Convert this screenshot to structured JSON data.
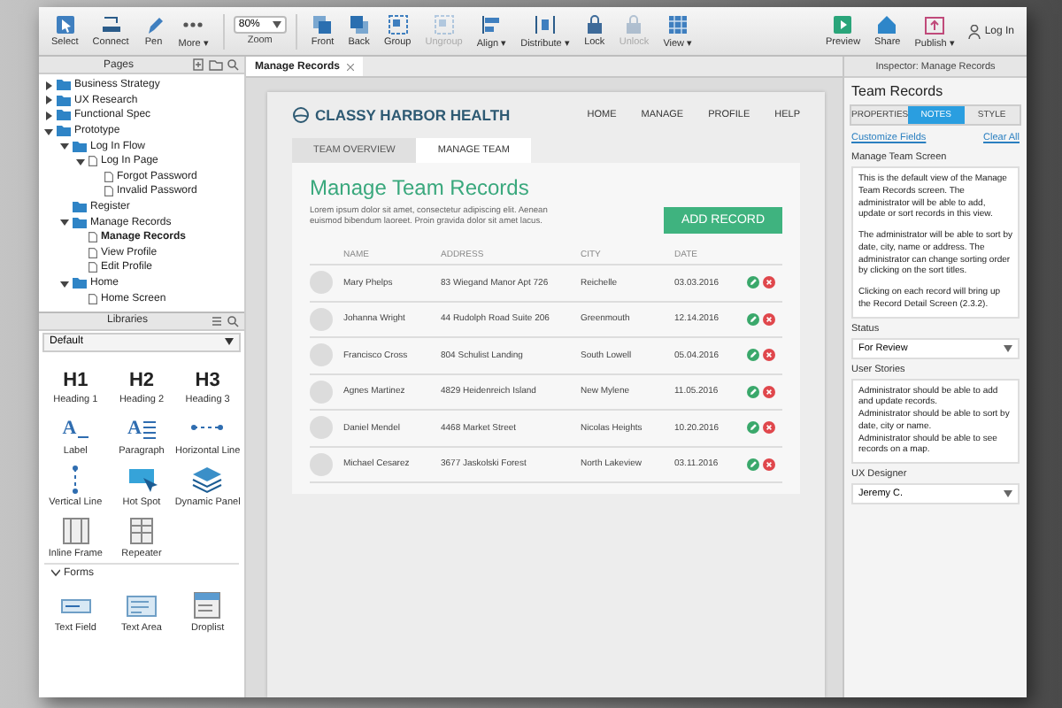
{
  "toolbar": {
    "tools": [
      {
        "label": "Select",
        "kind": "select"
      },
      {
        "label": "Connect",
        "kind": "connect"
      },
      {
        "label": "Pen",
        "kind": "pen"
      },
      {
        "label": "More ▾",
        "kind": "more"
      }
    ],
    "zoom": {
      "value": "80%",
      "label": "Zoom"
    },
    "arrange": [
      {
        "label": "Front",
        "kind": "front",
        "disabled": false
      },
      {
        "label": "Back",
        "kind": "back",
        "disabled": false
      },
      {
        "label": "Group",
        "kind": "group",
        "disabled": false
      },
      {
        "label": "Ungroup",
        "kind": "group",
        "disabled": true
      },
      {
        "label": "Align ▾",
        "kind": "align",
        "disabled": false
      },
      {
        "label": "Distribute ▾",
        "kind": "distribute",
        "disabled": false
      },
      {
        "label": "Lock",
        "kind": "lock",
        "disabled": false
      },
      {
        "label": "Unlock",
        "kind": "lock",
        "disabled": true
      },
      {
        "label": "View ▾",
        "kind": "view",
        "disabled": false
      }
    ],
    "actions": [
      {
        "label": "Preview",
        "kind": "preview"
      },
      {
        "label": "Share",
        "kind": "share"
      },
      {
        "label": "Publish ▾",
        "kind": "publish"
      }
    ],
    "login": "Log In"
  },
  "pages": {
    "title": "Pages",
    "items": [
      {
        "label": "Business Strategy",
        "kind": "folder",
        "selected": false,
        "expanded": false
      },
      {
        "label": "UX Research",
        "kind": "folder",
        "selected": false,
        "expanded": false
      },
      {
        "label": "Functional Spec",
        "kind": "folder",
        "selected": false,
        "expanded": false
      },
      {
        "label": "Prototype",
        "kind": "folder",
        "selected": false,
        "expanded": true,
        "children": [
          {
            "label": "Log In Flow",
            "kind": "folder",
            "selected": false,
            "expanded": true,
            "children": [
              {
                "label": "Log In Page",
                "kind": "page",
                "selected": false,
                "expanded": true,
                "children": [
                  {
                    "label": "Forgot Password",
                    "kind": "page",
                    "selected": false
                  },
                  {
                    "label": "Invalid Password",
                    "kind": "page",
                    "selected": false
                  }
                ]
              }
            ]
          },
          {
            "label": "Register",
            "kind": "folder",
            "selected": false
          },
          {
            "label": "Manage Records",
            "kind": "folder",
            "selected": false,
            "expanded": true,
            "children": [
              {
                "label": "Manage Records",
                "kind": "page",
                "selected": true
              },
              {
                "label": "View Profile",
                "kind": "page",
                "selected": false
              },
              {
                "label": "Edit Profile",
                "kind": "page",
                "selected": false
              }
            ]
          },
          {
            "label": "Home",
            "kind": "folder",
            "selected": false,
            "expanded": true,
            "children": [
              {
                "label": "Home Screen",
                "kind": "page",
                "selected": false
              }
            ]
          }
        ]
      }
    ]
  },
  "libraries": {
    "title": "Libraries",
    "library": "Default",
    "widgets": [
      {
        "label": "Heading 1",
        "kind": "heading",
        "glyph": "H1"
      },
      {
        "label": "Heading 2",
        "kind": "heading",
        "glyph": "H2"
      },
      {
        "label": "Heading 3",
        "kind": "heading",
        "glyph": "H3"
      },
      {
        "label": "Label",
        "kind": "label",
        "glyph": "A"
      },
      {
        "label": "Paragraph",
        "kind": "paragraph",
        "glyph": "A"
      },
      {
        "label": "Horizontal Line",
        "kind": "hline"
      },
      {
        "label": "Vertical Line",
        "kind": "vline"
      },
      {
        "label": "Hot Spot",
        "kind": "hotspot"
      },
      {
        "label": "Dynamic Panel",
        "kind": "panel"
      },
      {
        "label": "Inline Frame",
        "kind": "iframe"
      },
      {
        "label": "Repeater",
        "kind": "repeater"
      }
    ],
    "sections": [
      {
        "title": "Forms",
        "expanded": true,
        "widgets": [
          {
            "label": "Text Field",
            "kind": "textfield"
          },
          {
            "label": "Text Area",
            "kind": "textarea"
          },
          {
            "label": "Droplist",
            "kind": "droplist"
          }
        ]
      }
    ]
  },
  "canvas": {
    "tab": "Manage Records",
    "page": {
      "brand": "CLASSY HARBOR HEALTH",
      "nav": [
        "HOME",
        "MANAGE",
        "PROFILE",
        "HELP"
      ],
      "tabs": [
        {
          "label": "TEAM OVERVIEW",
          "selected": false
        },
        {
          "label": "MANAGE TEAM",
          "selected": true
        }
      ],
      "title": "Manage Team Records",
      "description": "Lorem ipsum dolor sit amet, consectetur adipiscing elit. Aenean euismod bibendum laoreet. Proin gravida dolor sit amet lacus.",
      "add_button": "ADD RECORD",
      "table": {
        "columns": [
          "NAME",
          "ADDRESS",
          "CITY",
          "DATE"
        ],
        "rows": [
          {
            "name": "Mary Phelps",
            "address": "83 Wiegand Manor Apt 726",
            "city": "Reichelle",
            "date": "03.03.2016"
          },
          {
            "name": "Johanna Wright",
            "address": "44 Rudolph Road Suite 206",
            "city": "Greenmouth",
            "date": "12.14.2016"
          },
          {
            "name": "Francisco Cross",
            "address": "804 Schulist Landing",
            "city": "South Lowell",
            "date": "05.04.2016"
          },
          {
            "name": "Agnes Martinez",
            "address": "4829 Heidenreich Island",
            "city": "New Mylene",
            "date": "11.05.2016"
          },
          {
            "name": "Daniel Mendel",
            "address": "4468 Market Street",
            "city": "Nicolas Heights",
            "date": "10.20.2016"
          },
          {
            "name": "Michael Cesarez",
            "address": "3677 Jaskolski Forest",
            "city": "North Lakeview",
            "date": "03.11.2016"
          }
        ]
      }
    }
  },
  "inspector": {
    "header": "Inspector: Manage Records",
    "title": "Team Records",
    "tabs": [
      {
        "label": "PROPERTIES",
        "selected": false
      },
      {
        "label": "NOTES",
        "selected": true
      },
      {
        "label": "STYLE",
        "selected": false
      }
    ],
    "customize_link": "Customize Fields",
    "clear_link": "Clear All",
    "fields": [
      {
        "label": "Manage Team Screen",
        "kind": "text",
        "paragraphs": [
          "This is the default view of the Manage Team Records screen. The administrator will be able to add, update or sort records in this view.",
          "The administrator will be able to sort by date, city, name or address. The administrator can change sorting order by clicking on the sort titles.",
          "Clicking on each record will bring up the Record Detail Screen (2.3.2)."
        ]
      },
      {
        "label": "Status",
        "kind": "select",
        "value": "For Review"
      },
      {
        "label": "User Stories",
        "kind": "text",
        "paragraphs": [
          "Administrator should be able to add and update records.",
          "Administrator should be able to sort by date, city or name.",
          "Administrator should be able to see records on a map."
        ]
      },
      {
        "label": "UX Designer",
        "kind": "select",
        "value": "Jeremy C."
      }
    ]
  }
}
